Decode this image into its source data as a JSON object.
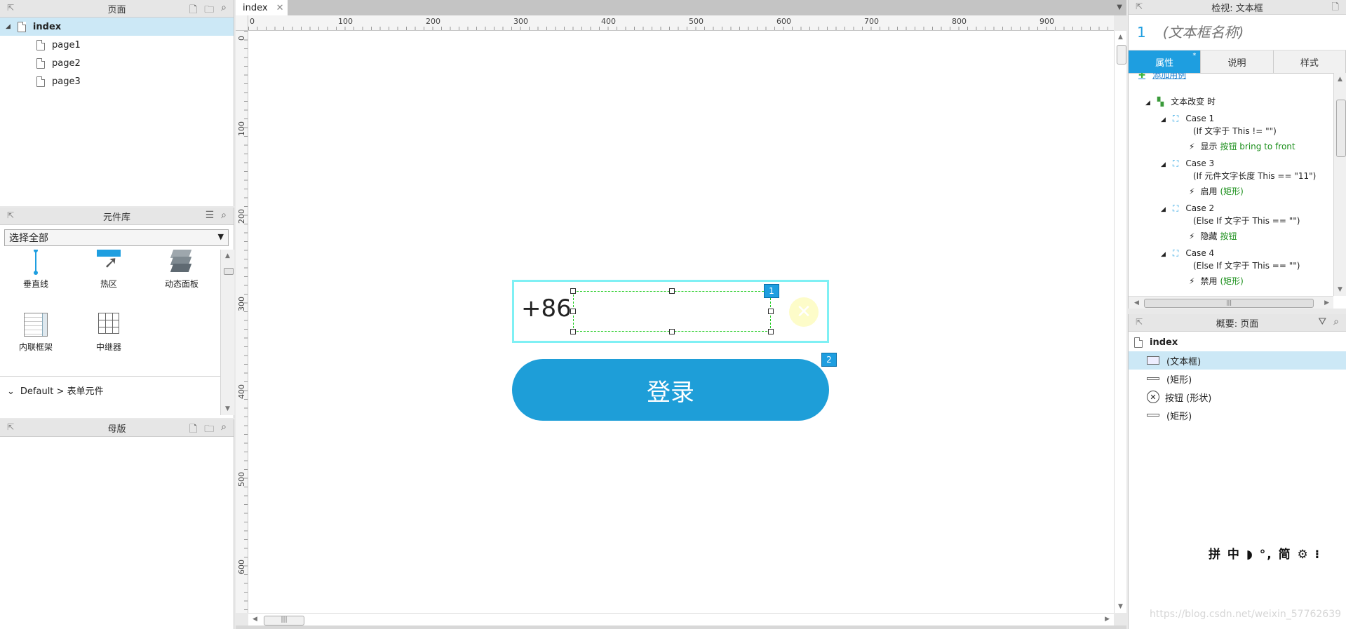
{
  "pages_panel": {
    "title": "页面",
    "root": "index",
    "children": [
      "page1",
      "page2",
      "page3"
    ]
  },
  "library_panel": {
    "title": "元件库",
    "select_value": "选择全部",
    "items": [
      "垂直线",
      "热区",
      "动态面板",
      "内联框架",
      "中继器"
    ],
    "group_label": "Default > 表单元件"
  },
  "masters_panel": {
    "title": "母版"
  },
  "canvas": {
    "tab_label": "index",
    "ruler_h": [
      "0",
      "100",
      "200",
      "300",
      "400",
      "500",
      "600",
      "700",
      "800",
      "900"
    ],
    "ruler_v": [
      "0",
      "100",
      "200",
      "300",
      "400",
      "500",
      "600"
    ],
    "prefix_text": "+86",
    "badge1": "1",
    "badge2": "2",
    "login_label": "登录"
  },
  "inspector": {
    "title": "检视: 文本框",
    "number": "1",
    "name_placeholder": "(文本框名称)",
    "tabs": [
      "属性",
      "说明",
      "样式"
    ],
    "add_case": "添加用例",
    "event": "文本改变 时",
    "cases": [
      {
        "name": "Case 1",
        "cond": "(If 文字于 This != \"\")",
        "action": "显示",
        "target": "按钮 bring to front"
      },
      {
        "name": "Case 3",
        "cond": "(If 元件文字长度 This == \"11\")",
        "action": "启用",
        "target": "(矩形)"
      },
      {
        "name": "Case 2",
        "cond": "(Else If 文字于 This == \"\")",
        "action": "隐藏",
        "target": "按钮"
      },
      {
        "name": "Case 4",
        "cond": "(Else If 文字于 This == \"\")",
        "action": "禁用",
        "target": "(矩形)"
      }
    ]
  },
  "outline": {
    "title": "概要: 页面",
    "root": "index",
    "items": [
      "(文本框)",
      "(矩形)",
      "按钮 (形状)",
      "(矩形)"
    ]
  },
  "ime_bar": "拼 中 ◗ °, 简 ⚙ ⁝",
  "watermark": "https://blog.csdn.net/weixin_57762639"
}
